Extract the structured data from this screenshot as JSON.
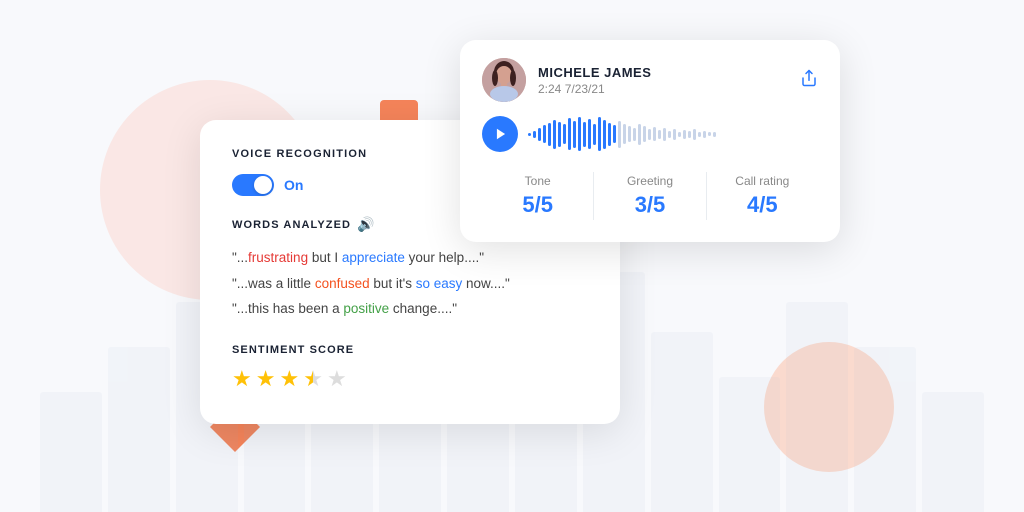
{
  "background": {
    "colors": {
      "primary_bg": "#f8f9fc",
      "circle_pink": "rgba(255,180,160,0.25)",
      "circle_peach": "rgba(255,160,120,0.35)",
      "orange_accent": "#f5845a"
    }
  },
  "audio_card": {
    "user_name": "MICHELE JAMES",
    "user_meta": "2:24   7/23/21",
    "share_icon": "↑",
    "metrics": [
      {
        "label": "Tone",
        "value": "5/5"
      },
      {
        "label": "Greeting",
        "value": "3/5"
      },
      {
        "label": "Call rating",
        "value": "4/5"
      }
    ]
  },
  "voice_card": {
    "title": "VOICE RECOGNITION",
    "toggle_state": "On",
    "toggle_active": true,
    "words_analyzed_label": "WORDS ANALYZED",
    "quotes": [
      {
        "parts": [
          {
            "text": "\"..."
          },
          {
            "text": "frustrating",
            "class": "word-negative"
          },
          {
            "text": " but I "
          },
          {
            "text": "appreciate",
            "class": "word-positive-blue"
          },
          {
            "text": " your help....\""
          }
        ]
      },
      {
        "parts": [
          {
            "text": "\"...was a little "
          },
          {
            "text": "confused",
            "class": "word-confused"
          },
          {
            "text": " but it's "
          },
          {
            "text": "so easy",
            "class": "word-easy"
          },
          {
            "text": " now....\""
          }
        ]
      },
      {
        "parts": [
          {
            "text": "\"...this has been a "
          },
          {
            "text": "positive",
            "class": "word-positive-green"
          },
          {
            "text": " change....\""
          }
        ]
      }
    ],
    "sentiment_label": "SENTIMENT SCORE",
    "stars_filled": 3,
    "stars_half": 1,
    "stars_empty": 1,
    "total_stars": 5
  },
  "waveform": {
    "bars": [
      3,
      8,
      14,
      20,
      26,
      32,
      28,
      22,
      36,
      30,
      38,
      28,
      34,
      24,
      38,
      32,
      26,
      20,
      30,
      22,
      18,
      14,
      24,
      18,
      12,
      16,
      10,
      14,
      8,
      12,
      6,
      10,
      8,
      12,
      6,
      8,
      4,
      6
    ]
  }
}
